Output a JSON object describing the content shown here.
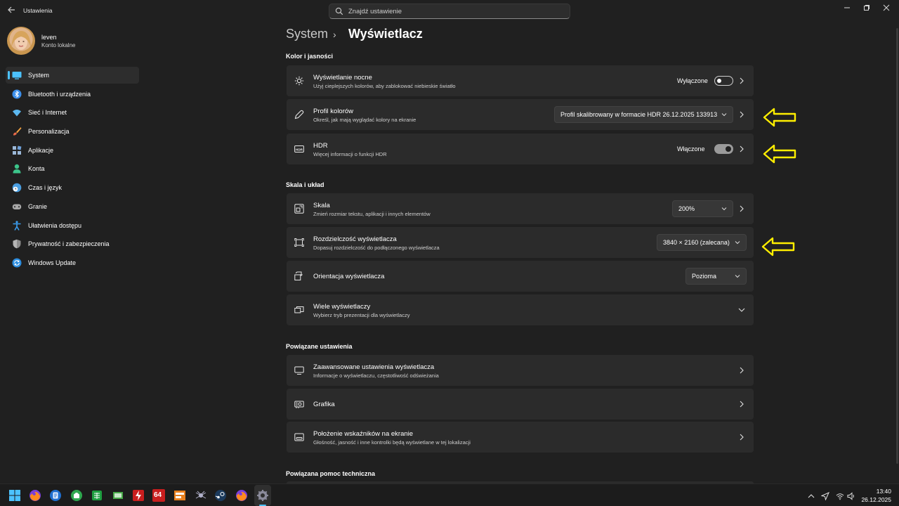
{
  "window": {
    "app_title": "Ustawienia"
  },
  "search": {
    "placeholder": "Znajdź ustawienie"
  },
  "profile": {
    "name": "leven",
    "account_type": "Konto lokalne"
  },
  "sidebar": {
    "items": [
      {
        "label": "System",
        "icon": "system-icon",
        "active": true
      },
      {
        "label": "Bluetooth i urządzenia",
        "icon": "bluetooth-icon"
      },
      {
        "label": "Sieć i Internet",
        "icon": "wifi-icon"
      },
      {
        "label": "Personalizacja",
        "icon": "brush-icon"
      },
      {
        "label": "Aplikacje",
        "icon": "apps-icon"
      },
      {
        "label": "Konta",
        "icon": "person-icon"
      },
      {
        "label": "Czas i język",
        "icon": "globe-clock-icon"
      },
      {
        "label": "Granie",
        "icon": "gamepad-icon"
      },
      {
        "label": "Ułatwienia dostępu",
        "icon": "accessibility-icon"
      },
      {
        "label": "Prywatność i zabezpieczenia",
        "icon": "shield-icon"
      },
      {
        "label": "Windows Update",
        "icon": "update-icon"
      }
    ]
  },
  "breadcrumb": {
    "parent": "System",
    "separator": "›",
    "current": "Wyświetlacz"
  },
  "sections": {
    "color": {
      "title": "Kolor i jasności",
      "night_light": {
        "title": "Wyświetlanie nocne",
        "subtitle": "Użyj cieplejszych kolorów, aby zablokować niebieskie światło",
        "status": "Wyłączone",
        "on": false
      },
      "color_profile": {
        "title": "Profil kolorów",
        "subtitle": "Określ, jak mają wyglądać kolory na ekranie",
        "value": "Profil skalibrowany w formacie HDR 26.12.2025 133913"
      },
      "hdr": {
        "title": "HDR",
        "subtitle": "Więcej informacji o funkcji HDR",
        "status": "Włączone",
        "on": true
      }
    },
    "scale": {
      "title": "Skala i układ",
      "scale": {
        "title": "Skala",
        "subtitle": "Zmień rozmiar tekstu, aplikacji i innych elementów",
        "value": "200%"
      },
      "resolution": {
        "title": "Rozdzielczość wyświetlacza",
        "subtitle": "Dopasuj rozdzielczość do podłączonego wyświetlacza",
        "value": "3840 × 2160 (zalecana)"
      },
      "orientation": {
        "title": "Orientacja wyświetlacza",
        "value": "Pozioma"
      },
      "multi": {
        "title": "Wiele wyświetlaczy",
        "subtitle": "Wybierz tryb prezentacji dla wyświetlaczy"
      }
    },
    "related": {
      "title": "Powiązane ustawienia",
      "advanced": {
        "title": "Zaawansowane ustawienia wyświetlacza",
        "subtitle": "Informacje o wyświetlaczu, częstotliwość odświeżania"
      },
      "graphics": {
        "title": "Grafika"
      },
      "indicators": {
        "title": "Położenie wskaźników na ekranie",
        "subtitle": "Głośność, jasność i inne kontrolki będą wyświetlane w tej lokalizacji"
      }
    },
    "help": {
      "title": "Powiązana pomoc techniczna"
    }
  },
  "taskbar": {
    "badge_64": "64",
    "clock": {
      "time": "13:40",
      "date": "26.12.2025"
    }
  },
  "colors": {
    "accent": "#4cc2ff",
    "annotation_arrow": "#ffee00",
    "background": "#202020",
    "card": "#2b2b2b"
  }
}
